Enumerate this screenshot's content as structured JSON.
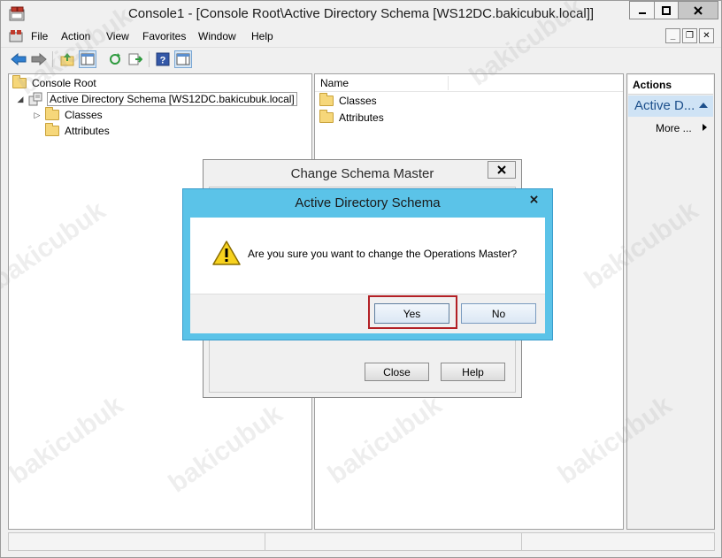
{
  "window": {
    "title": "Console1 - [Console Root\\Active Directory Schema [WS12DC.bakicubuk.local]]",
    "controls": {
      "minimize": "▁",
      "maximize": "□",
      "close": "✕"
    }
  },
  "menubar": {
    "items": [
      "File",
      "Action",
      "View",
      "Favorites",
      "Window",
      "Help"
    ],
    "mdi": {
      "minimize": "_",
      "restore": "❐",
      "close": "✕"
    }
  },
  "toolbar": {
    "buttons": [
      "back-arrow-icon",
      "forward-arrow-icon",
      "up-folder-icon",
      "show-hide-tree-icon",
      "refresh-icon",
      "export-list-icon",
      "help-icon",
      "show-hide-action-pane-icon"
    ]
  },
  "tree": {
    "root": "Console Root",
    "schema": "Active Directory Schema [WS12DC.bakicubuk.local]",
    "children": [
      "Classes",
      "Attributes"
    ]
  },
  "list": {
    "column_name": "Name",
    "items": [
      "Classes",
      "Attributes"
    ]
  },
  "actions": {
    "header": "Actions",
    "section": "Active D...",
    "more": "More ..."
  },
  "dialog_back": {
    "title": "Change Schema Master",
    "close_label": "Close",
    "help_label": "Help"
  },
  "dialog": {
    "title": "Active Directory Schema",
    "message": "Are you sure you want to change the Operations Master?",
    "yes_label": "Yes",
    "no_label": "No"
  },
  "watermark": "bakicubuk",
  "colors": {
    "dialog_border": "#5bc3e8",
    "actions_section_bg": "#cfe3f5",
    "highlight": "#b32025"
  }
}
